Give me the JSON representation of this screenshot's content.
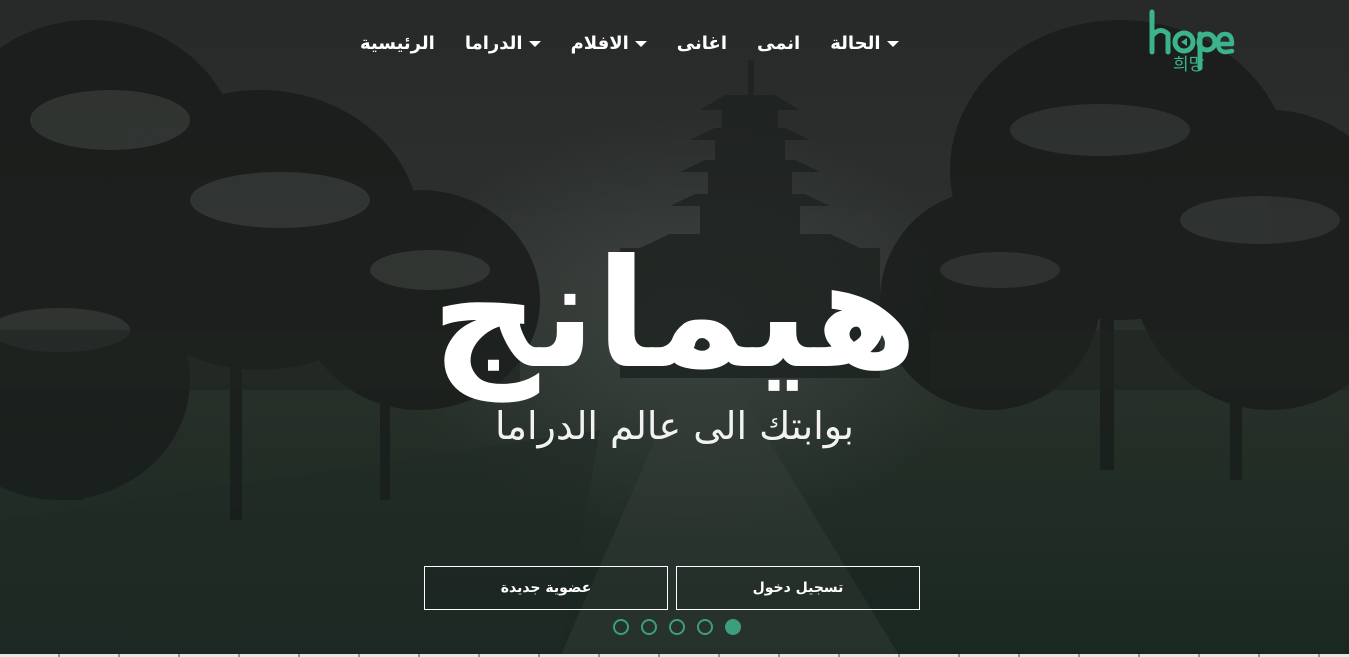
{
  "logo": {
    "word": "hope",
    "korean": "희망",
    "color": "#3bb38d"
  },
  "nav": {
    "items": [
      {
        "label": "الرئيسية",
        "dropdown": false
      },
      {
        "label": "الدراما",
        "dropdown": true
      },
      {
        "label": "الافلام",
        "dropdown": true
      },
      {
        "label": "اغانى",
        "dropdown": false
      },
      {
        "label": "انمى",
        "dropdown": false
      },
      {
        "label": "الحالة",
        "dropdown": true
      }
    ]
  },
  "hero": {
    "title": "هيمانج",
    "subtitle": "بوابتك الى عالم الدراما"
  },
  "buttons": {
    "login": "تسجيل دخول",
    "signup": "عضوية جديدة"
  },
  "carousel": {
    "count": 5,
    "active_index": 4,
    "accent": "#3d9e7e"
  }
}
